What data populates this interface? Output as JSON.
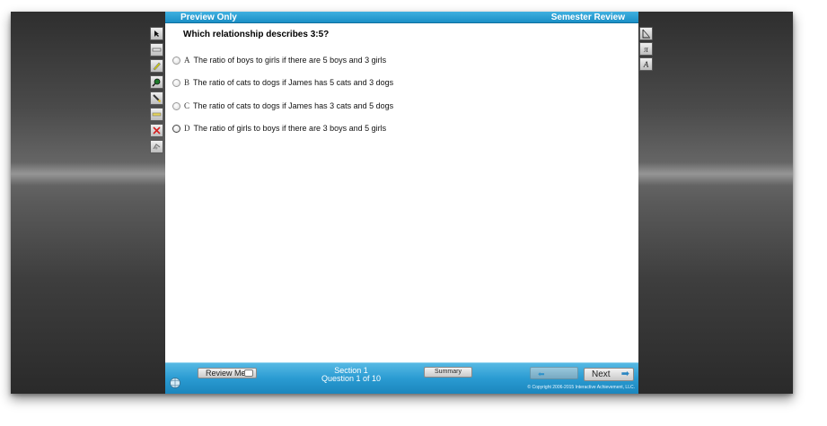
{
  "header": {
    "left_label": "Preview Only",
    "right_label": "Semester Review"
  },
  "question": {
    "prompt": "Which relationship describes 3:5?",
    "options": [
      {
        "letter": "A",
        "text": "The ratio of boys to girls if there are 5 boys and 3 girls"
      },
      {
        "letter": "B",
        "text": "The ratio of cats to dogs if James has 5 cats and 3 dogs"
      },
      {
        "letter": "C",
        "text": "The ratio of cats to dogs if James has 3 cats and 5 dogs"
      },
      {
        "letter": "D",
        "text": "The ratio of girls to boys if there are 3 boys and 5 girls"
      }
    ]
  },
  "footer": {
    "review_label": "Review Me",
    "section_label": "Section 1",
    "question_counter": "Question 1 of 10",
    "summary_label": "Summary",
    "next_label": "Next",
    "copyright": "© Copyright 2006-2015 Interactive Achievement, LLC."
  },
  "tools": {
    "left": [
      "pointer-icon",
      "eraser-icon",
      "highlighter-icon",
      "magnifier-icon",
      "pencil-icon",
      "ruler-icon",
      "strikethrough-icon",
      "clear-icon"
    ],
    "right": [
      "protractor-icon",
      "pi-icon",
      "formula-icon"
    ],
    "pi_glyph": "π",
    "formula_glyph": "A"
  },
  "colors": {
    "accent": "#1a8fc6",
    "bar_light": "#56b9e4"
  }
}
